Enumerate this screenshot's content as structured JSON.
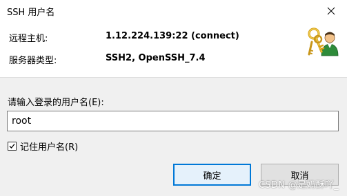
{
  "window": {
    "title": "SSH 用户名"
  },
  "info": {
    "host_label": "远程主机:",
    "host_value": "1.12.224.139:22 (connect)",
    "server_type_label": "服务器类型:",
    "server_type_value": "SSH2, OpenSSH_7.4"
  },
  "form": {
    "prompt": "请输入登录的用户名(E):",
    "username_value": "root",
    "remember_label": "记住用户名(R)",
    "remember_checked": true
  },
  "buttons": {
    "ok_label": "确定",
    "cancel_label": "取消"
  },
  "watermark": "CSDN @是奶酥吖_",
  "icons": {
    "close": "close-icon",
    "keys": "keys-user-icon",
    "check": "checkmark-icon"
  },
  "colors": {
    "accent": "#0078d7",
    "background": "#f0f0f0",
    "header_background": "#ffffff"
  }
}
